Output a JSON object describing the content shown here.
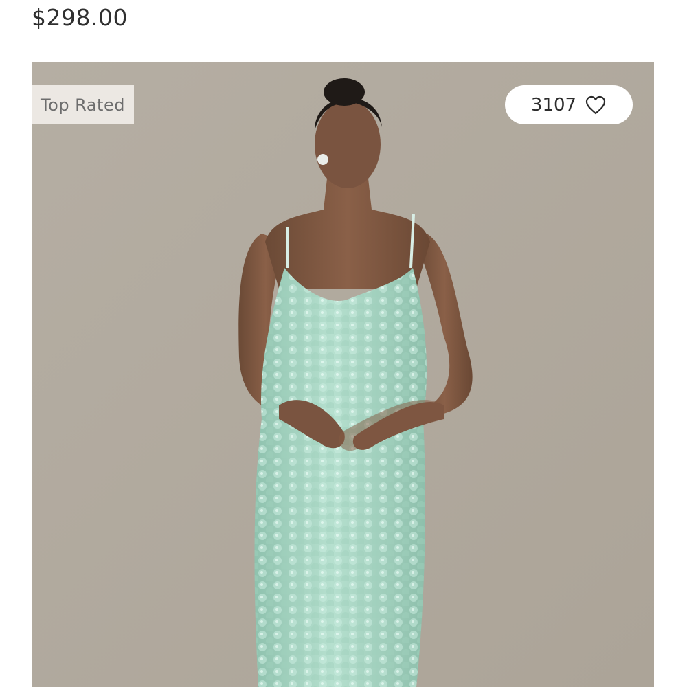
{
  "product": {
    "price": "$298.00",
    "badge": "Top Rated",
    "favorites_count": "3107",
    "image_alt": "Model wearing a mint sequin slip dress"
  },
  "icons": {
    "favorite": "heart-outline-icon"
  },
  "colors": {
    "backdrop": "#b3aca1",
    "dress": "#a9d6c4",
    "badge_background": "#ece8e3"
  }
}
